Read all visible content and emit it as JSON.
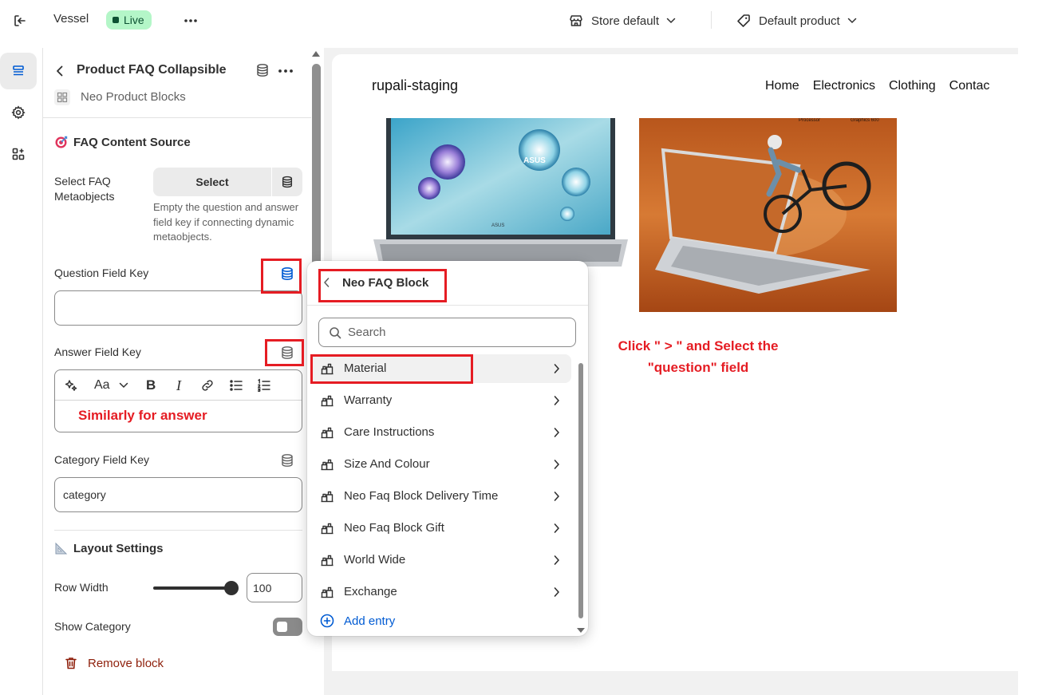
{
  "topbar": {
    "app_name": "Vessel",
    "status": "Live",
    "store_select": "Store default",
    "product_select": "Default product"
  },
  "panel": {
    "title": "Product FAQ Collapsible",
    "app_block_name": "Neo Product Blocks",
    "faq_section": {
      "title": "FAQ Content Source",
      "select_label": "Select FAQ Metaobjects",
      "select_button": "Select",
      "help_text": "Empty the question and answer field key if connecting dynamic metaobjects."
    },
    "question_field": {
      "label": "Question Field Key",
      "value": ""
    },
    "answer_field": {
      "label": "Answer Field Key",
      "note": "Similarly for answer"
    },
    "category_field": {
      "label": "Category Field Key",
      "value": "category"
    },
    "layout_section": {
      "title": "Layout Settings",
      "row_width_label": "Row Width",
      "row_width_value": "100",
      "row_width_fraction": 1.0,
      "show_category_label": "Show Category",
      "show_category_on": false
    },
    "remove_block": "Remove block"
  },
  "preview": {
    "store_name": "rupali-staging",
    "nav": [
      "Home",
      "Electronics",
      "Clothing",
      "Contac"
    ]
  },
  "popover": {
    "title": "Neo FAQ Block",
    "search_placeholder": "Search",
    "items": [
      "Material",
      "Warranty",
      "Care Instructions",
      "Size And Colour",
      "Neo Faq Block Delivery Time",
      "Neo Faq Block Gift",
      "World Wide",
      "Exchange"
    ],
    "add_entry": "Add entry"
  },
  "annotation": {
    "line1": "Click \" > \" and Select the",
    "line2": "\"question\" field"
  },
  "colors": {
    "highlight": "#e51c23",
    "live_badge": "#b4f6c8",
    "link_blue": "#005bd3",
    "remove_red": "#8e1f0b"
  },
  "icons": {
    "exit": "exit-icon",
    "more": "more-horizontal-icon",
    "store": "store-icon",
    "tag": "tag-icon",
    "sections": "sections-icon",
    "settings": "gear-icon",
    "apps": "apps-icon",
    "database": "database-icon",
    "metaobject": "metaobject-icon"
  }
}
